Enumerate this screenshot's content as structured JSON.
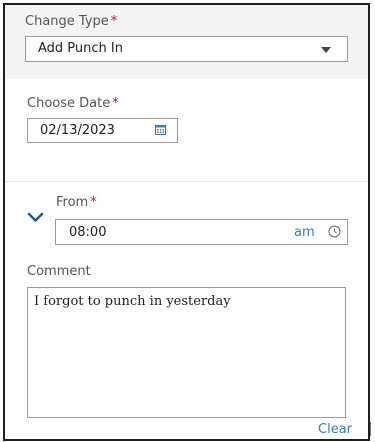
{
  "change_type": {
    "label": "Change Type",
    "required_mark": "*",
    "selected": "Add Punch In"
  },
  "choose_date": {
    "label": "Choose Date",
    "required_mark": "*",
    "value": "02/13/2023"
  },
  "from": {
    "label": "From",
    "required_mark": "*",
    "time": "08:00",
    "meridiem": "am"
  },
  "comment": {
    "label": "Comment",
    "value": "I forgot to punch in yesterday"
  },
  "clear_label": "Clear",
  "icons": {
    "dropdown": "chevron-down-icon",
    "calendar": "calendar-icon",
    "expand": "chevron-down-icon",
    "clock": "clock-icon"
  },
  "colors": {
    "accent": "#2f7fbf",
    "required": "#c8102e",
    "expand_chevron": "#1f5f96"
  }
}
